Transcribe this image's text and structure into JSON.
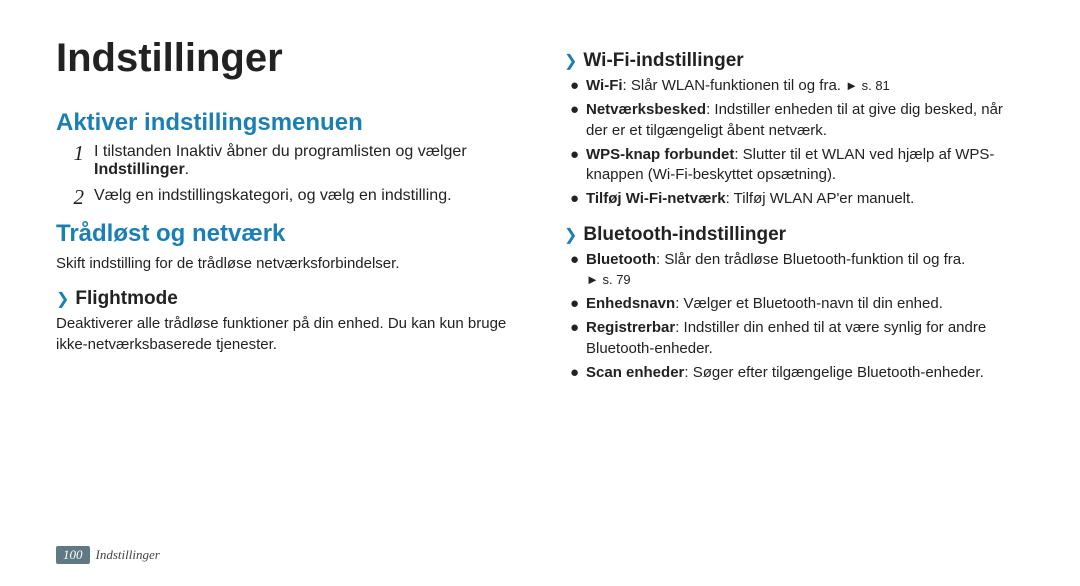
{
  "title": "Indstillinger",
  "h2_activate": "Aktiver indstillingsmenuen",
  "steps": {
    "1_num": "1",
    "1_prefix": "I tilstanden Inaktiv åbner du programlisten og vælger ",
    "1_bold": "Indstillinger",
    "1_suffix": ".",
    "2_num": "2",
    "2_text": "Vælg en indstillingskategori, og vælg en indstilling."
  },
  "h2_wireless": "Trådløst og netværk",
  "wireless_intro": "Skift indstilling for de trådløse netværksforbindelser.",
  "h3_flight": "Flightmode",
  "flight_text": "Deaktiverer alle trådløse funktioner på din enhed. Du kan kun bruge ikke-netværksbaserede tjenester.",
  "h3_wifi": "Wi-Fi-indstillinger",
  "wifi": {
    "b1_lead": "Wi-Fi",
    "b1_text": ": Slår WLAN-funktionen til og fra. ",
    "b1_ref": "► s. 81",
    "b2_lead": "Netværksbesked",
    "b2_text": ": Indstiller enheden til at give dig besked, når der er et tilgængeligt åbent netværk.",
    "b3_lead": "WPS-knap forbundet",
    "b3_text": ": Slutter til et WLAN ved hjælp af WPS-knappen (Wi-Fi-beskyttet opsætning).",
    "b4_lead": "Tilføj Wi-Fi-netværk",
    "b4_text": ": Tilføj WLAN AP'er manuelt."
  },
  "h3_bt": "Bluetooth-indstillinger",
  "bt": {
    "b1_lead": "Bluetooth",
    "b1_text": ": Slår den trådløse Bluetooth-funktion til og fra.",
    "b1_ref": "► s. 79",
    "b2_lead": "Enhedsnavn",
    "b2_text": ": Vælger et Bluetooth-navn til din enhed.",
    "b3_lead": "Registrerbar",
    "b3_text": ": Indstiller din enhed til at være synlig for andre Bluetooth-enheder.",
    "b4_lead": "Scan enheder",
    "b4_text": ": Søger efter tilgængelige Bluetooth-enheder."
  },
  "chevron": "❯",
  "bullet": "●",
  "page_number": "100",
  "footer_title": "Indstillinger"
}
